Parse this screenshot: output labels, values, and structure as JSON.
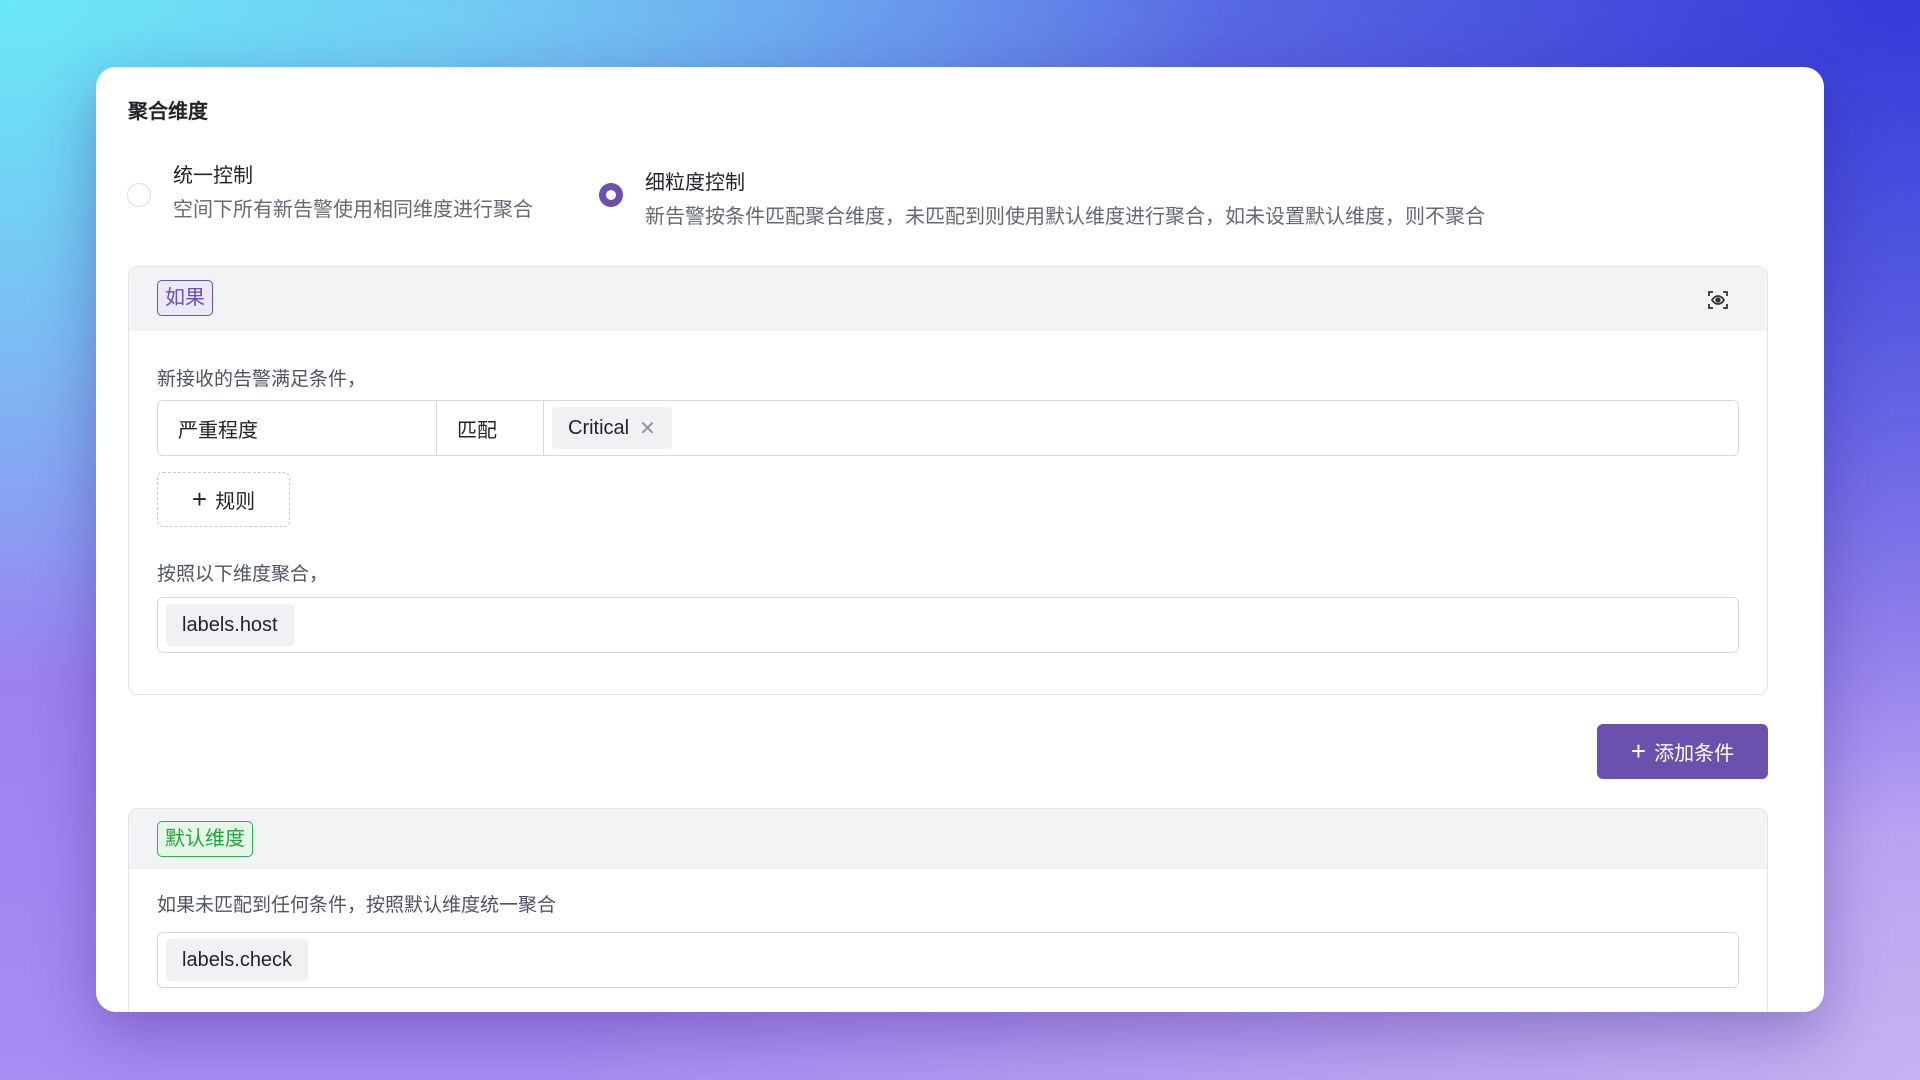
{
  "section_title": "聚合维度",
  "modes": [
    {
      "label": "统一控制",
      "description": "空间下所有新告警使用相同维度进行聚合",
      "selected": false
    },
    {
      "label": "细粒度控制",
      "description": "新告警按条件匹配聚合维度，未匹配到则使用默认维度进行聚合，如未设置默认维度，则不聚合",
      "selected": true
    }
  ],
  "condition": {
    "tag": "如果",
    "match_label": "新接收的告警满足条件，",
    "rule": {
      "field": "严重程度",
      "operator": "匹配",
      "values": [
        "Critical"
      ]
    },
    "add_rule_label": "规则",
    "group_label": "按照以下维度聚合，",
    "dimensions": [
      "labels.host"
    ],
    "icon": "eye-scan-icon"
  },
  "add_condition_label": "添加条件",
  "default": {
    "tag": "默认维度",
    "description": "如果未匹配到任何条件，按照默认维度统一聚合",
    "dimensions": [
      "labels.check"
    ]
  },
  "colors": {
    "primary": "#6b50ad",
    "success": "#2bb24c"
  }
}
